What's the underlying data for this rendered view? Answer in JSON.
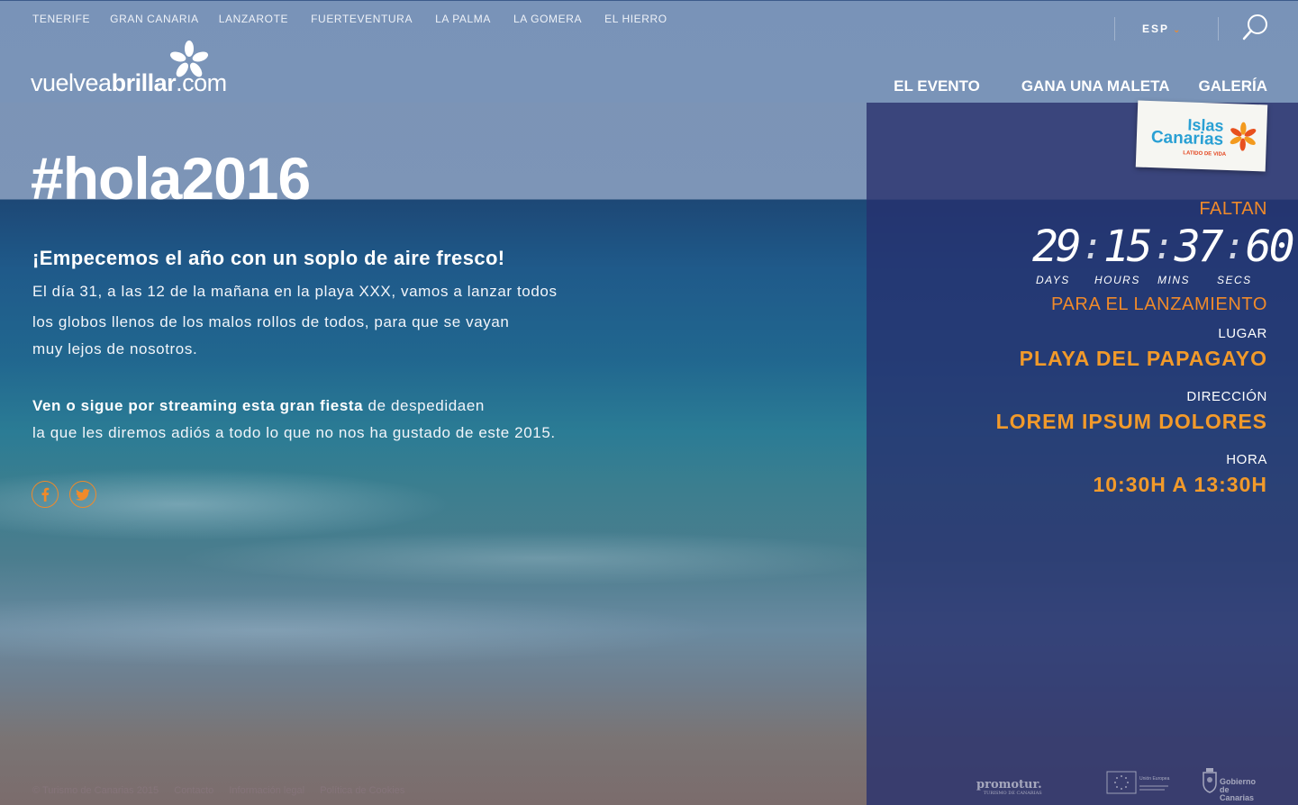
{
  "header": {
    "islands": [
      "TENERIFE",
      "GRAN CANARIA",
      "LANZAROTE",
      "FUERTEVENTURA",
      "LA PALMA",
      "LA GOMERA",
      "EL HIERRO"
    ],
    "logo": {
      "part1": "vuelvea",
      "part2": "brillar",
      "part3": ".com"
    },
    "language": "ESP",
    "main_nav": [
      "EL EVENTO",
      "GANA UNA MALETA",
      "GALERÍA"
    ]
  },
  "badge": {
    "line1": "Islas",
    "line2": "Canarias",
    "tagline": "LATIDO DE VIDA"
  },
  "main": {
    "hashtag": "#hola2016",
    "intro_title": "¡Empecemos el año con un soplo de aire fresco!",
    "intro_line1": "El día 31, a las 12 de la mañana en la playa XXX, vamos a lanzar todos",
    "intro_line2": "los globos llenos de los malos rollos de todos, para que se vayan",
    "intro_line3": "muy lejos de nosotros.",
    "stream_bold": "Ven o sigue por streaming esta gran fiesta",
    "stream_rest": " de despedidaen",
    "stream_line2": "la que les diremos adiós a todo lo que no nos ha gustado de este 2015."
  },
  "social": {
    "facebook": "f",
    "twitter": "t"
  },
  "countdown": {
    "faltan": "FALTAN",
    "days": "29",
    "hours": "15",
    "mins": "37",
    "secs": "60",
    "days_label": "DAYS",
    "hours_label": "HOURS",
    "mins_label": "MINS",
    "secs_label": "SECS",
    "para": "PARA EL LANZAMIENTO"
  },
  "event": {
    "lugar_label": "LUGAR",
    "lugar_value": "PLAYA DEL PAPAGAYO",
    "direccion_label": "DIRECCIÓN",
    "direccion_value": "LOREM IPSUM DOLORES",
    "hora_label": "HORA",
    "hora_value": "10:30H A 13:30H"
  },
  "footer": {
    "links": [
      "© Turismo de Canarias 2015",
      "Contacto",
      "Información legal",
      "Política de Cookies"
    ],
    "promotur": "promotur.",
    "promotur_sub": "TURISMO DE CANARIAS",
    "eu_label": "Unión Europea",
    "gob_line1": "Gobierno",
    "gob_line2": "de Canarias"
  },
  "colors": {
    "accent": "#f08a2a",
    "panel": "#26306e",
    "header": "#7894b9"
  }
}
